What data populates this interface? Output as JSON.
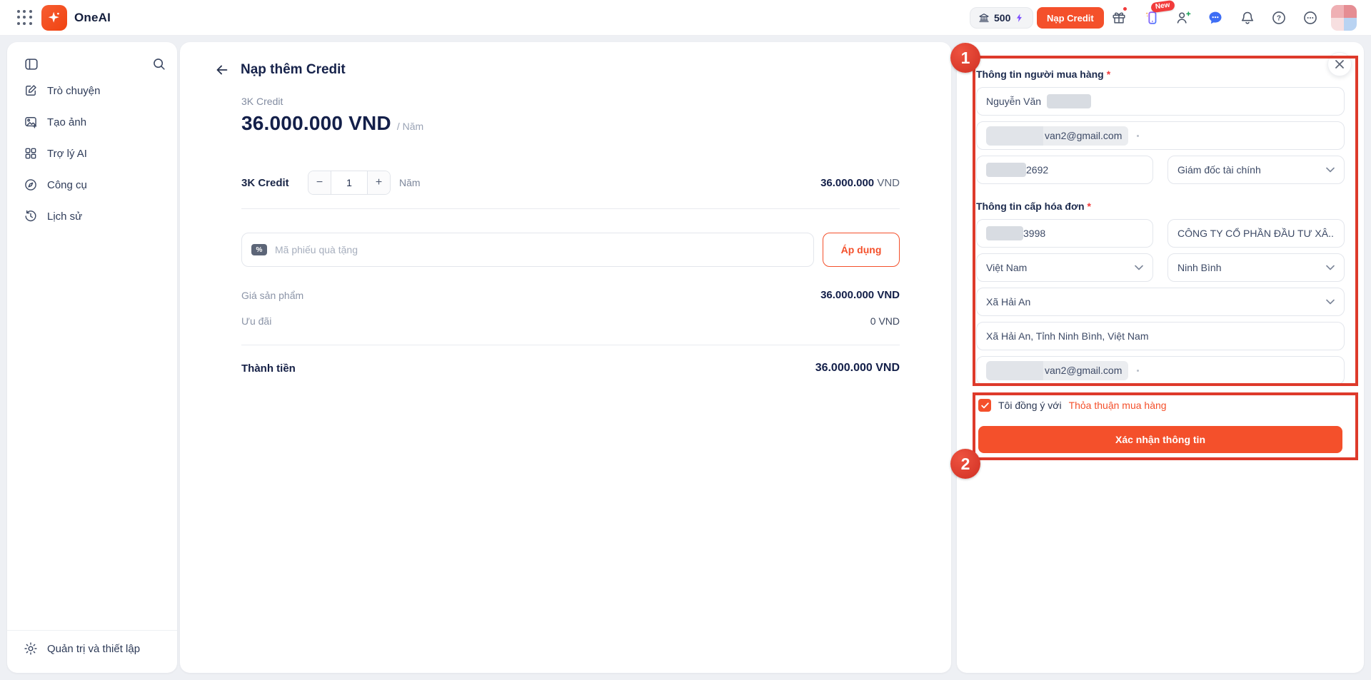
{
  "header": {
    "app_name": "OneAI",
    "credit_balance": "500",
    "topup_button": "Nạp Credit",
    "new_badge": "New"
  },
  "sidebar": {
    "items": [
      {
        "label": "Trò chuyện"
      },
      {
        "label": "Tạo ảnh"
      },
      {
        "label": "Trợ lý AI"
      },
      {
        "label": "Công cụ"
      },
      {
        "label": "Lịch sử"
      }
    ],
    "footer": {
      "label": "Quản trị và thiết lập"
    }
  },
  "main": {
    "title": "Nạp thêm Credit",
    "plan_label": "3K Credit",
    "price": "36.000.000 VND",
    "price_period": "/ Năm",
    "quantity_row": {
      "label": "3K Credit",
      "minus": "−",
      "quantity": "1",
      "plus": "+",
      "unit": "Năm",
      "amount": "36.000.000",
      "currency": "VND"
    },
    "voucher": {
      "icon_glyph": "%",
      "placeholder": "Mã phiếu quà tặng",
      "apply_button": "Áp dụng"
    },
    "summary": {
      "product_price_label": "Giá sản phẩm",
      "product_price_value": "36.000.000 VND",
      "discount_label": "Ưu đãi",
      "discount_value": "0 VND",
      "total_label": "Thành tiền",
      "total_value": "36.000.000 VND"
    }
  },
  "panel": {
    "buyer_section_label": "Thông tin người mua hàng",
    "required_mark": "*",
    "buyer_name": "Nguyễn Văn",
    "buyer_email_visible": "van2@gmail.com",
    "buyer_phone_visible": "2692",
    "buyer_position": "Giám đốc tài chính",
    "invoice_section_label": "Thông tin cấp hóa đơn",
    "tax_code_visible": "3998",
    "company_name": "CÔNG TY CỔ PHẦN ĐẦU TƯ XÂ...",
    "country": "Việt Nam",
    "province": "Ninh Bình",
    "ward": "Xã Hải An",
    "address": "Xã Hải An, Tỉnh Ninh Bình, Việt Nam",
    "invoice_email_visible": "van2@gmail.com",
    "agree_prefix": "Tôi đồng ý với",
    "agreement_link": "Thỏa thuận mua hàng",
    "confirm_button": "Xác nhận thông tin"
  },
  "annotations": {
    "step1": "1",
    "step2": "2"
  },
  "colors": {
    "brand_orange": "#F4502B",
    "annotation_red": "#DE3A2B",
    "bolt_purple": "#7C4DFF",
    "chat_blue": "#3E6EF5",
    "badge_red": "#F23B3B"
  }
}
